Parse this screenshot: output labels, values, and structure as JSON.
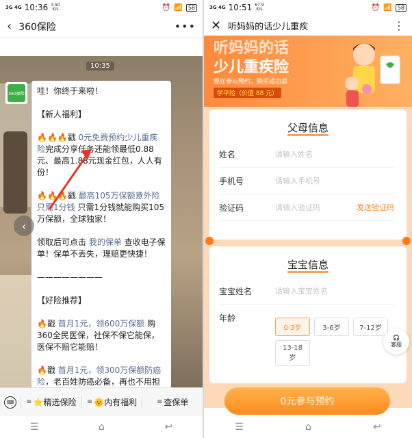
{
  "left": {
    "status": {
      "signal": "3G 4G",
      "time": "10:36",
      "netspeed_value": "3.50",
      "netspeed_unit": "K/s",
      "battery": "58"
    },
    "title": "360保险",
    "timestamp": "10:35",
    "avatar_text": "360保险",
    "message": {
      "greeting": "哇！你终于来啦！",
      "section1": "【新人福利】",
      "item1_prefix": "🔥🔥🔥戳 ",
      "item1_link": "0元免费预约少儿重疾险",
      "item1_rest": "完成分享任务还能领最低0.88元、最高1.88元现金红包，人人有份！",
      "item2_prefix": "🔥🔥🔥戳 ",
      "item2_link": "最高105万保额意外险只需1分钱",
      "item2_rest": " 只需1分钱就能购买105万保额，全球独家！",
      "item3_a": "领取后可点击 ",
      "item3_link": "我的保单",
      "item3_b": " 查收电子保单！保单不丢失，理赔更快捷！",
      "divider": "————————",
      "section2": "【好险推荐】",
      "item4_prefix": "🔥戳 ",
      "item4_link": "首月1元，领600万保额",
      "item4_rest": " 购360全民医保，社保不保它能保，医保不赔它能赔！",
      "item5_prefix": "🔥戳 ",
      "item5_link": "首月1元，领300万保额防癌险",
      "item5_rest": "，老百姓防癌必备，再也不用担"
    },
    "menu": [
      {
        "label": "⭐精选保险"
      },
      {
        "label": "🌞内有福利"
      },
      {
        "label": "查保单"
      }
    ]
  },
  "right": {
    "status": {
      "signal": "3G 4G",
      "time": "10:51",
      "netspeed_value": "67.9",
      "netspeed_unit": "K/s",
      "battery": "58"
    },
    "title": "听妈妈的话少儿重疾",
    "hero": {
      "title1": "听妈妈的话",
      "title2": "少儿重疾险",
      "sub": "现在参与预约，购买成功返",
      "badge": "学平险（价值 88 元）"
    },
    "parent_card": {
      "heading": "父母信息",
      "fields": [
        {
          "label": "姓名",
          "placeholder": "请输入姓名"
        },
        {
          "label": "手机号",
          "placeholder": "请输入手机号"
        },
        {
          "label": "验证码",
          "placeholder": "请输入验证码",
          "action": "发送验证码"
        }
      ]
    },
    "baby_card": {
      "heading": "宝宝信息",
      "name_label": "宝宝姓名",
      "name_placeholder": "请输入宝宝姓名",
      "age_label": "年龄",
      "ages": [
        "0-3岁",
        "3-6岁",
        "7-12岁",
        "13-18岁"
      ],
      "selected_age": "0-3岁"
    },
    "service_label": "客服",
    "cta": "0元参与预约"
  }
}
